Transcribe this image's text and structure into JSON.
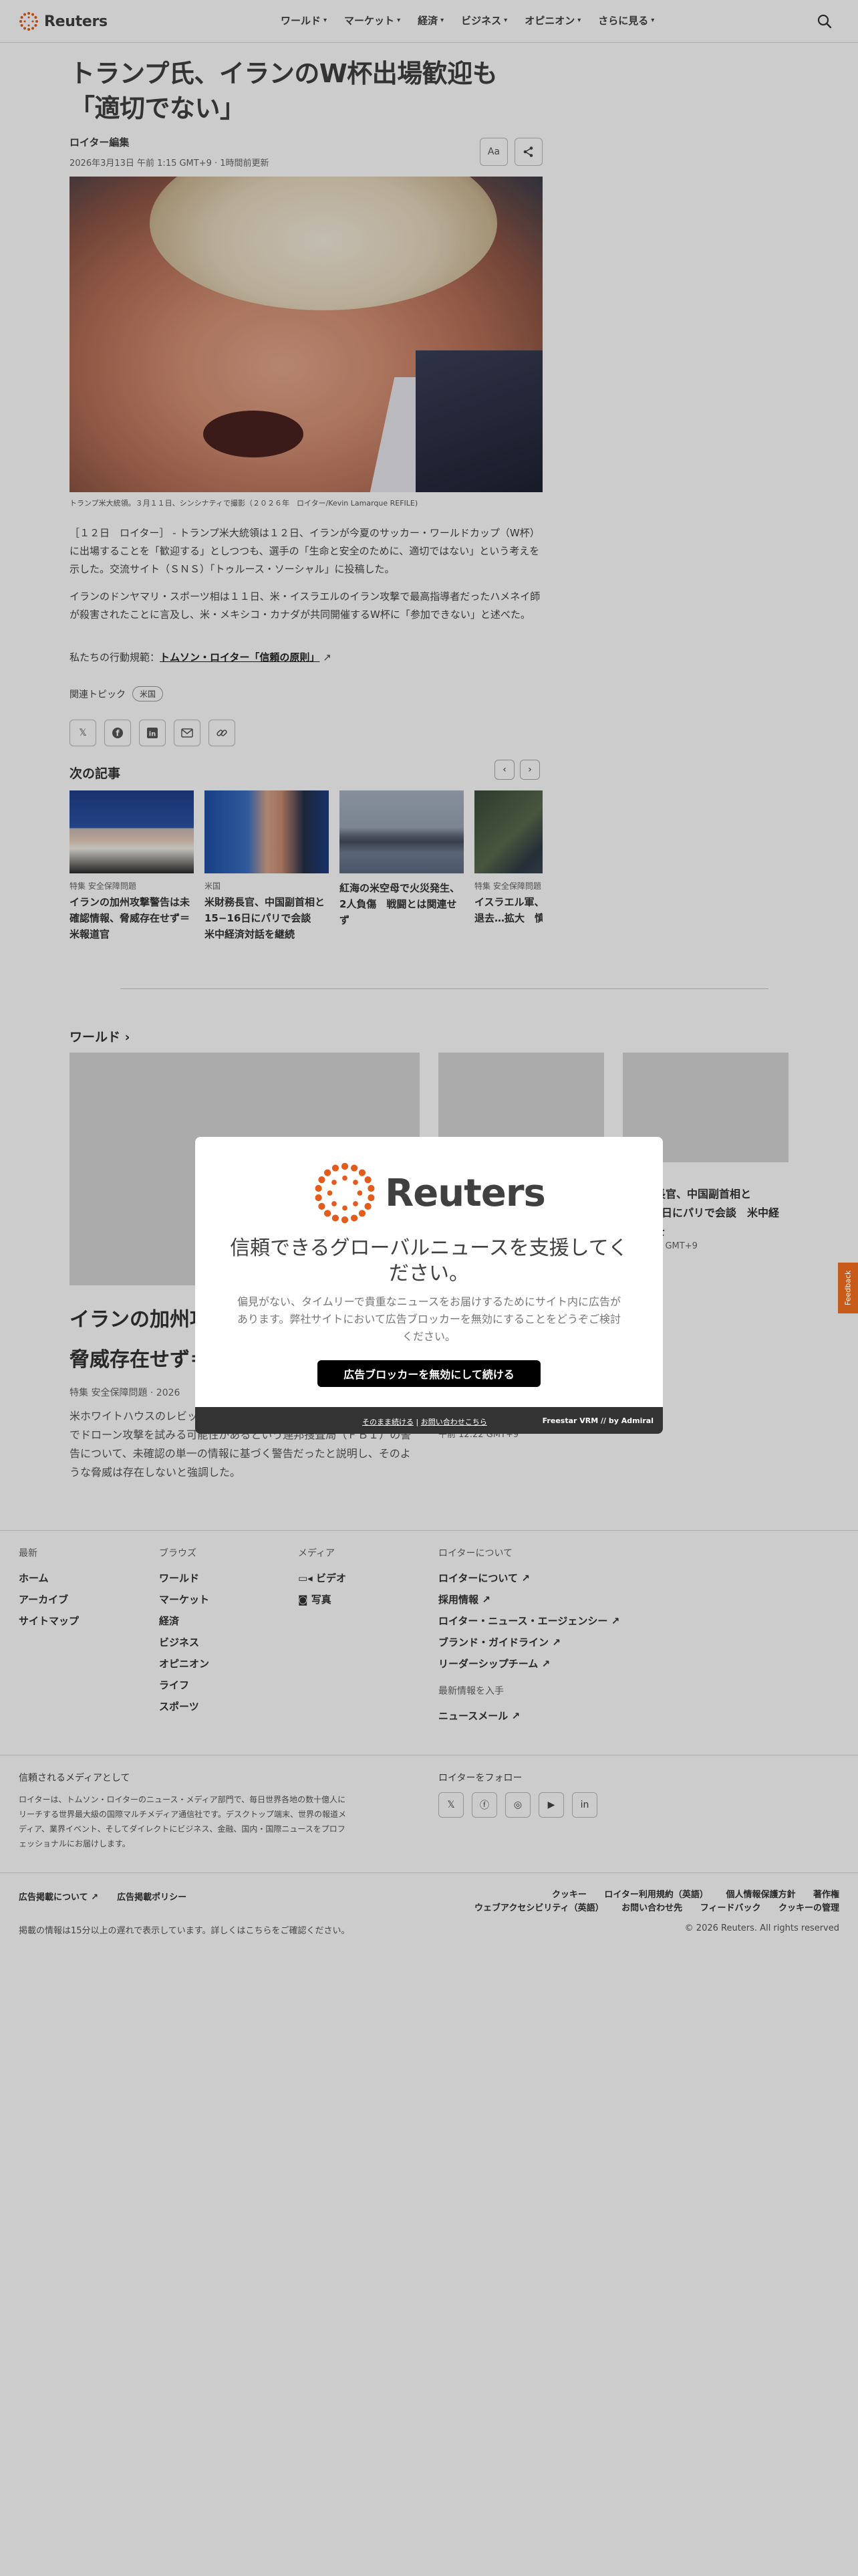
{
  "header": {
    "logo_text": "Reuters",
    "nav": [
      "ワールド",
      "マーケット",
      "経済",
      "ビジネス",
      "オピニオン",
      "さらに見る"
    ],
    "search_icon": "search-icon"
  },
  "article": {
    "headline": "トランプ氏、イランのW杯出場歓迎も「適切でない」",
    "byline": "ロイター編集",
    "dateline": "2026年3月13日 午前 1:15 GMT+9 · 1時間前更新",
    "font_size_button": "Aa",
    "caption": "トランプ米大統領。３月１１日、シンシナティで撮影（２０２６年　ロイター/Kevin Lamarque REFILE)",
    "paragraphs": [
      "［１２日　ロイター］ - トランプ米大統領は１２日、イランが今夏のサッカー・ワールドカップ（W杯）に出場することを「歓迎する」としつつも、選手の「生命と安全のために、適切ではない」という考えを示した。交流サイト（ＳＮＳ）「トゥルース・ソーシャル」に投稿した。",
      "イランのドンヤマリ・スポーツ相は１１日、米・イスラエルのイラン攻撃で最高指導者だったハメネイ師が殺害されたことに言及し、米・メキシコ・カナダが共同開催するW杯に「参加できない」と述べた。"
    ],
    "principles_prefix": "私たちの行動規範：",
    "principles_link": "トムソン・ロイター「信頼の原則」",
    "topics_label": "関連トピック",
    "topic_tag": "米国"
  },
  "next": {
    "title": "次の記事",
    "cards": [
      {
        "category": "特集 安全保障問題",
        "headline": "イランの加州攻撃警告は未確認情報、脅威存在せず＝米報道官"
      },
      {
        "category": "米国",
        "headline": "米財務長官、中国副首相と15−16日にパリで会談　米中経済対話を継続"
      },
      {
        "category": "",
        "headline": "紅海の米空母で火災発生、2人負傷　戦闘とは関連せず"
      },
      {
        "category": "特集 安全保障問題",
        "headline": "イスラエル軍、…部の住民退去…拡大　慎上の…"
      }
    ]
  },
  "world": {
    "title": "ワールド",
    "main_headline": "イランの加州攻撃警告は未確認情報、脅威存在せず＝米報道官",
    "main_category": "特集 安全保障問題 · 2026",
    "main_body": "米ホワイトハウスのレビット報道官は12日、イランがカリフォルニア州でドローン攻撃を試みる可能性があるという連邦捜査局（ＦＢＩ）の警告について、未確認の単一の情報に基づく警告だったと説明し、そのような脅威は存在しないと強調した。",
    "side_headline": "米財務長官、中国副首相と15−16日にパリで会談　米中経済対話を",
    "side_date": "午前 1:16 GMT+9",
    "side_date2": "午前 12:22 GMT+9"
  },
  "footer": {
    "cols": [
      {
        "heading": "最新",
        "items": [
          "ホーム",
          "アーカイブ",
          "サイトマップ"
        ]
      },
      {
        "heading": "ブラウズ",
        "items": [
          "ワールド",
          "マーケット",
          "経済",
          "ビジネス",
          "オピニオン",
          "ライフ",
          "スポーツ"
        ]
      },
      {
        "heading": "メディア",
        "items": [
          "ビデオ",
          "写真"
        ]
      },
      {
        "heading": "ロイターについて",
        "items": [
          "ロイターについて",
          "採用情報",
          "ロイター・ニュース・エージェンシー",
          "ブランド・ガイドライン",
          "リーダーシップチーム"
        ]
      }
    ],
    "newsletter_heading": "最新情報を入手",
    "newsletter_item": "ニュースメール",
    "trusted_heading": "信頼されるメディアとして",
    "trusted_text": "ロイターは、トムソン・ロイターのニュース・メディア部門で、毎日世界各地の数十億人にリーチする世界最大級の国際マルチメディア通信社です。デスクトップ端末、世界の報道メディア、業界イベント、そしてダイレクトにビジネス、金融、国内・国際ニュースをプロフェッショナルにお届けします。",
    "follow_heading": "ロイターをフォロー",
    "ads": [
      "広告掲載について",
      "広告掲載ポリシー"
    ],
    "links": [
      "クッキー",
      "ロイター利用規約（英語）",
      "個人情報保護方針",
      "著作権",
      "ウェブアクセシビリティ（英語）",
      "お問い合わせ先",
      "フィードバック",
      "クッキーの管理"
    ],
    "delay_note": "掲載の情報は15分以上の遅れで表示しています。詳しくはこちらをご確認ください。",
    "copyright": "© 2026 Reuters. All rights reserved"
  },
  "feedback_label": "Feedback",
  "modal": {
    "logo_text": "Reuters",
    "title": "信頼できるグローバルニュースを支援してください。",
    "text": "偏見がない、タイムリーで貴重なニュースをお届けするためにサイト内に広告があります。弊社サイトにおいて広告ブロッカーを無効にすることをどうぞご検討ください。",
    "button": "広告ブロッカーを無効にして続ける",
    "continue_link": "そのまま続ける",
    "contact_link": "お問い合わせこちら",
    "brand": "Freestar VRM // by Admiral"
  },
  "colors": {
    "reuters_orange": "#e45c1c",
    "overlay": "rgba(0,0,0,0.2)"
  }
}
